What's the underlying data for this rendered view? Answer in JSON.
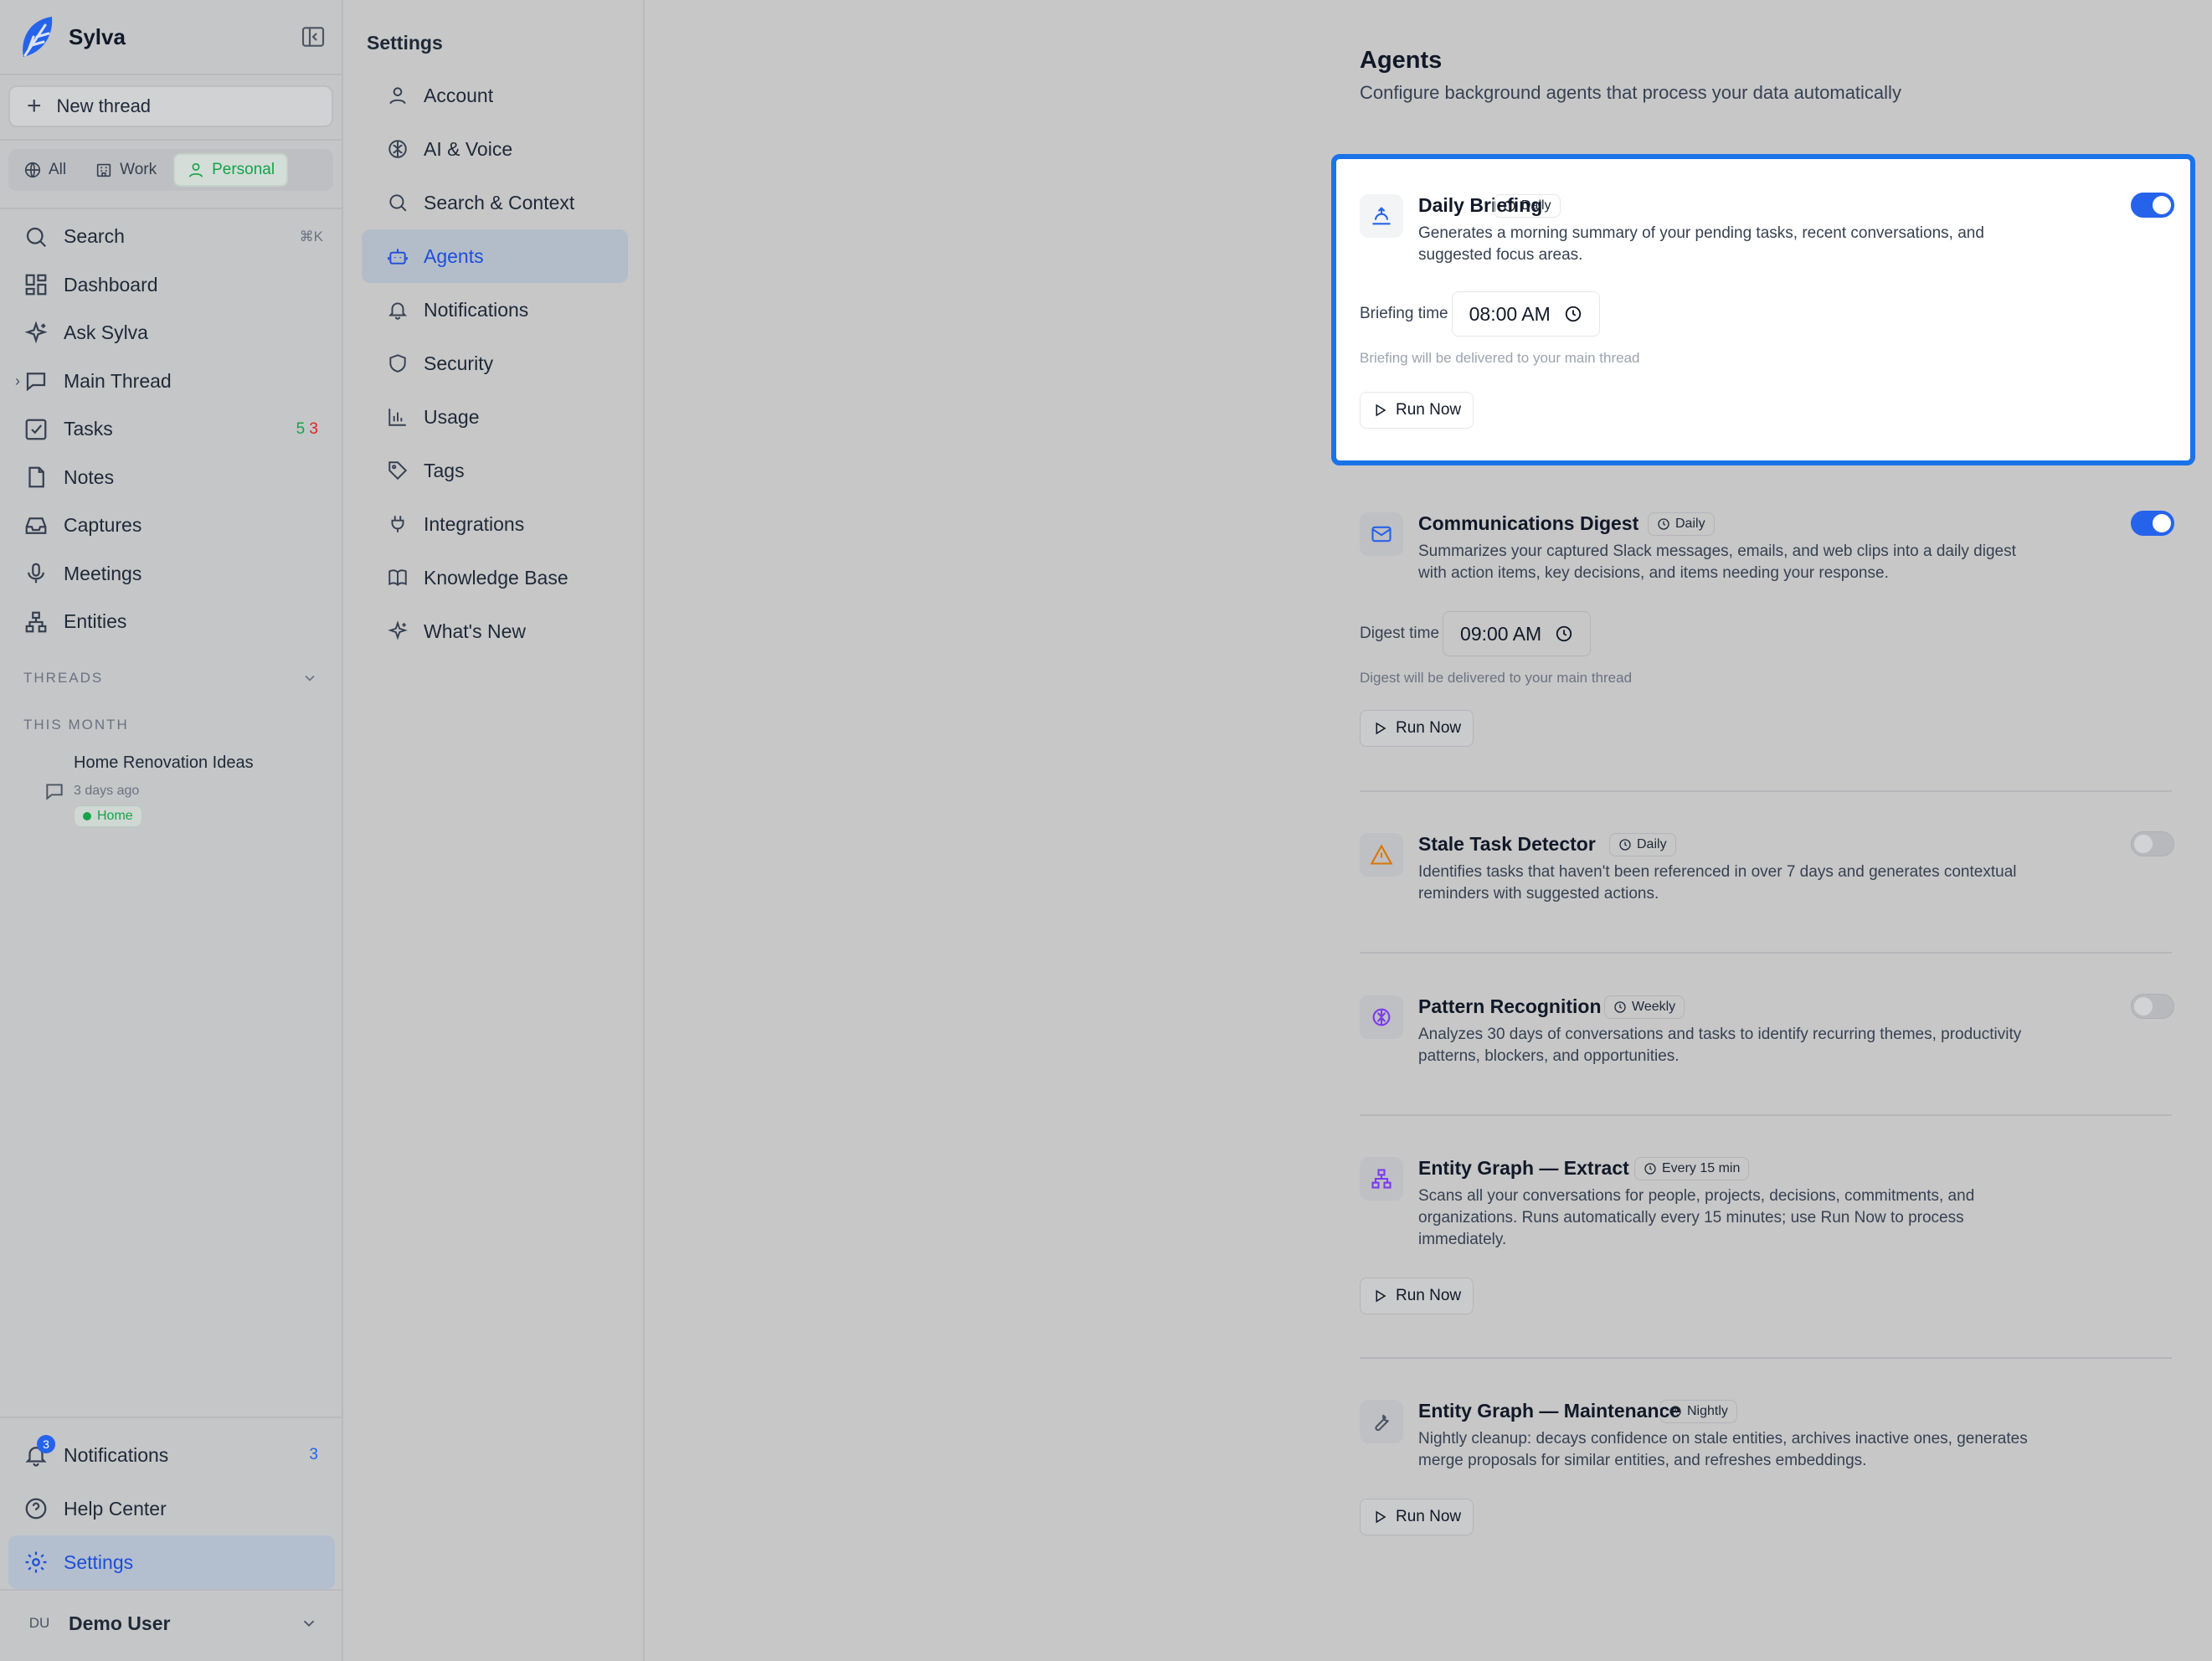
{
  "app": {
    "name": "Sylva"
  },
  "sidebar": {
    "new_thread": "New thread",
    "scopes": [
      "All",
      "Work",
      "Personal"
    ],
    "active_scope": "Personal",
    "search": {
      "label": "Search",
      "shortcut": "⌘K"
    },
    "items": [
      {
        "label": "Dashboard",
        "icon": "dashboard-icon"
      },
      {
        "label": "Ask Sylva",
        "icon": "sparkle-icon"
      },
      {
        "label": "Main Thread",
        "icon": "chat-icon"
      },
      {
        "label": "Tasks",
        "icon": "checkbox-icon",
        "count_open": "5",
        "count_overdue": "3"
      },
      {
        "label": "Notes",
        "icon": "document-icon"
      },
      {
        "label": "Captures",
        "icon": "inbox-icon"
      },
      {
        "label": "Meetings",
        "icon": "microphone-icon"
      },
      {
        "label": "Entities",
        "icon": "network-icon"
      }
    ],
    "threads_label": "THREADS",
    "this_month_label": "THIS MONTH",
    "thread": {
      "title": "Home Renovation Ideas",
      "time": "3 days ago",
      "tag": "Home"
    },
    "bottom": {
      "notifications": {
        "label": "Notifications",
        "badge": "3",
        "count": "3"
      },
      "help": "Help Center",
      "settings": "Settings"
    },
    "user": {
      "initials": "DU",
      "name": "Demo User"
    }
  },
  "settings_nav": {
    "title": "Settings",
    "items": [
      "Account",
      "AI & Voice",
      "Search & Context",
      "Agents",
      "Notifications",
      "Security",
      "Usage",
      "Tags",
      "Integrations",
      "Knowledge Base",
      "What's New"
    ],
    "active": "Agents"
  },
  "page": {
    "title": "Agents",
    "subtitle": "Configure background agents that process your data automatically"
  },
  "agents": [
    {
      "name": "Daily Briefing",
      "frequency": "Daily",
      "enabled": true,
      "description": "Generates a morning summary of your pending tasks, recent conversations, and suggested focus areas.",
      "time_label": "Briefing time",
      "time": "08:00 AM",
      "note": "Briefing will be delivered to your main thread",
      "run": "Run Now",
      "icon": "sunrise-icon"
    },
    {
      "name": "Communications Digest",
      "frequency": "Daily",
      "enabled": true,
      "description": "Summarizes your captured Slack messages, emails, and web clips into a daily digest with action items, key decisions, and items needing your response.",
      "time_label": "Digest time",
      "time": "09:00 AM",
      "note": "Digest will be delivered to your main thread",
      "run": "Run Now",
      "icon": "mail-icon"
    },
    {
      "name": "Stale Task Detector",
      "frequency": "Daily",
      "enabled": false,
      "description": "Identifies tasks that haven't been referenced in over 7 days and generates contextual reminders with suggested actions.",
      "icon": "warning-icon"
    },
    {
      "name": "Pattern Recognition",
      "frequency": "Weekly",
      "enabled": false,
      "description": "Analyzes 30 days of conversations and tasks to identify recurring themes, productivity patterns, blockers, and opportunities.",
      "icon": "brain-icon"
    },
    {
      "name": "Entity Graph — Extract",
      "frequency": "Every 15 min",
      "description": "Scans all your conversations for people, projects, decisions, commitments, and organizations. Runs automatically every 15 minutes; use Run Now to process immediately.",
      "run": "Run Now",
      "icon": "graph-icon"
    },
    {
      "name": "Entity Graph — Maintenance",
      "frequency": "Nightly",
      "description": "Nightly cleanup: decays confidence on stale entities, archives inactive ones, generates merge proposals for similar entities, and refreshes embeddings.",
      "run": "Run Now",
      "icon": "wrench-icon"
    }
  ],
  "colors": {
    "accent": "#2563eb",
    "highlight_border": "#1a73e8",
    "success": "#16a34a",
    "danger": "#dc2626"
  }
}
